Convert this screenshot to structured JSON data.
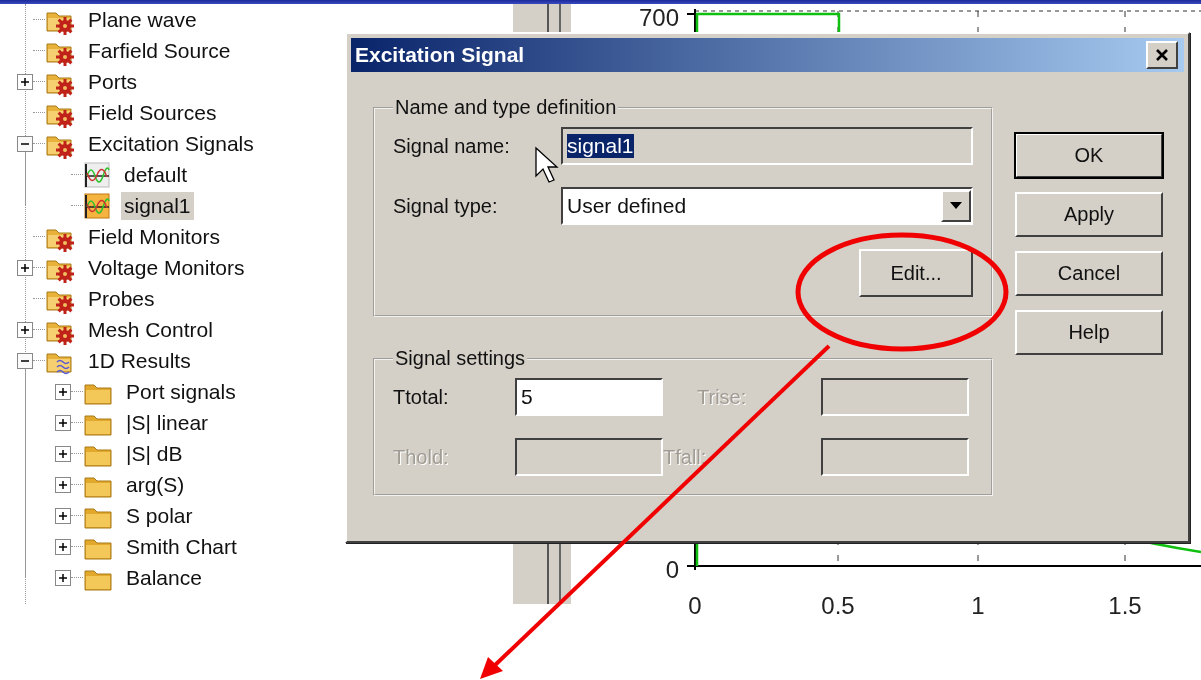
{
  "tree": [
    {
      "label": "Plane wave",
      "kind": "category",
      "expandable": false,
      "selected": false
    },
    {
      "label": "Farfield Source",
      "kind": "category",
      "expandable": false,
      "selected": false
    },
    {
      "label": "Ports",
      "kind": "category",
      "expandable": true,
      "expanded": false,
      "selected": false
    },
    {
      "label": "Field Sources",
      "kind": "category",
      "expandable": false,
      "selected": false
    },
    {
      "label": "Excitation Signals",
      "kind": "category",
      "expandable": true,
      "expanded": true,
      "selected": false,
      "children": [
        {
          "label": "default",
          "kind": "signal",
          "expandable": false,
          "selected": false
        },
        {
          "label": "signal1",
          "kind": "signal",
          "expandable": false,
          "selected": true
        }
      ]
    },
    {
      "label": "Field Monitors",
      "kind": "category",
      "expandable": false,
      "selected": false
    },
    {
      "label": "Voltage Monitors",
      "kind": "category",
      "expandable": true,
      "expanded": false,
      "selected": false
    },
    {
      "label": "Probes",
      "kind": "category",
      "expandable": false,
      "selected": false
    },
    {
      "label": "Mesh Control",
      "kind": "category",
      "expandable": true,
      "expanded": false,
      "selected": false
    },
    {
      "label": "1D Results",
      "kind": "results",
      "expandable": true,
      "expanded": true,
      "selected": false,
      "children": [
        {
          "label": "Port signals",
          "kind": "folder",
          "expandable": true,
          "expanded": false,
          "selected": false
        },
        {
          "label": "|S| linear",
          "kind": "folder",
          "expandable": true,
          "expanded": false,
          "selected": false
        },
        {
          "label": "|S| dB",
          "kind": "folder",
          "expandable": true,
          "expanded": false,
          "selected": false
        },
        {
          "label": "arg(S)",
          "kind": "folder",
          "expandable": true,
          "expanded": false,
          "selected": false
        },
        {
          "label": "S polar",
          "kind": "folder",
          "expandable": true,
          "expanded": false,
          "selected": false
        },
        {
          "label": "Smith Chart",
          "kind": "folder",
          "expandable": true,
          "expanded": false,
          "selected": false
        },
        {
          "label": "Balance",
          "kind": "folder",
          "expandable": true,
          "expanded": false,
          "selected": false
        }
      ]
    }
  ],
  "chart": {
    "y_tick_labels": [
      "700",
      "0"
    ],
    "x_tick_labels": [
      "0",
      "0.5",
      "1",
      "1.5"
    ]
  },
  "dialog": {
    "title": "Excitation Signal",
    "groups": [
      {
        "title": "Name and type definition",
        "kind": "definition",
        "fields": [
          {
            "label": "Signal name:",
            "kind": "text",
            "value": "signal1",
            "text_selected": true,
            "disabled": true
          },
          {
            "label": "Signal type:",
            "kind": "dropdown",
            "value": "User defined",
            "disabled": false
          }
        ],
        "button": "Edit..."
      },
      {
        "title": "Signal settings",
        "kind": "settings",
        "fields": [
          {
            "label": "Ttotal:",
            "kind": "text",
            "value": "5",
            "disabled": false
          },
          {
            "label": "Trise:",
            "kind": "text",
            "disabled": true
          },
          {
            "label": "Thold:",
            "kind": "text",
            "disabled": true
          },
          {
            "label": "Tfall:",
            "kind": "text",
            "disabled": true
          }
        ]
      }
    ],
    "buttons": [
      {
        "label": "OK",
        "default": true
      },
      {
        "label": "Apply",
        "default": false
      },
      {
        "label": "Cancel",
        "default": false
      },
      {
        "label": "Help",
        "default": false
      }
    ]
  },
  "mouse_pointer": true,
  "highlight_ellipse": true,
  "callout_arrow": true
}
